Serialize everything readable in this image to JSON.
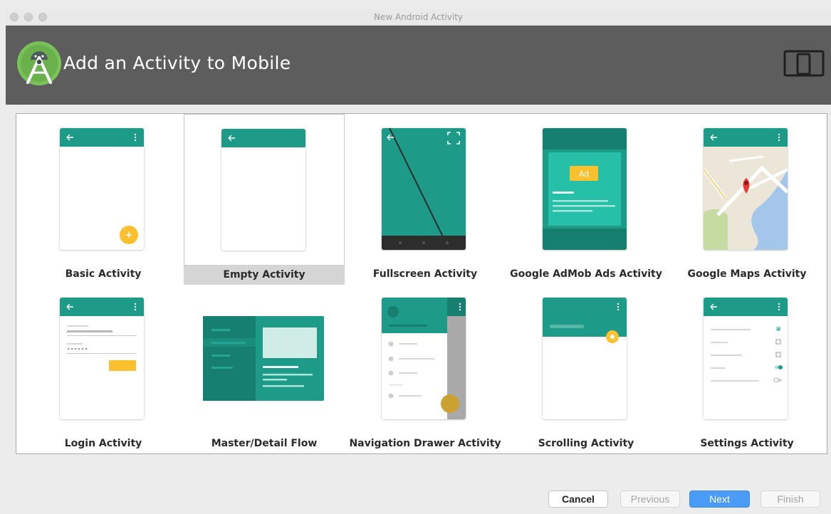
{
  "window": {
    "title": "New Android Activity",
    "header_title": "Add an Activity to Mobile"
  },
  "icons": {
    "logo": "android-studio-logo",
    "device": "phone-tablet-icon"
  },
  "colors": {
    "header_bg": "#5d5d5d",
    "teal": "#1e9b88",
    "teal_dark": "#177f70",
    "accent_yellow": "#fbc02d",
    "primary_button": "#4a9bf5"
  },
  "templates": [
    {
      "id": "basic",
      "label": "Basic Activity",
      "selected": false
    },
    {
      "id": "empty",
      "label": "Empty Activity",
      "selected": true
    },
    {
      "id": "fullscreen",
      "label": "Fullscreen Activity",
      "selected": false
    },
    {
      "id": "admob",
      "label": "Google AdMob Ads Activity",
      "selected": false,
      "badge": "Ad"
    },
    {
      "id": "maps",
      "label": "Google Maps Activity",
      "selected": false
    },
    {
      "id": "login",
      "label": "Login Activity",
      "selected": false
    },
    {
      "id": "masterdetail",
      "label": "Master/Detail Flow",
      "selected": false
    },
    {
      "id": "navdrawer",
      "label": "Navigation Drawer Activity",
      "selected": false
    },
    {
      "id": "scrolling",
      "label": "Scrolling Activity",
      "selected": false
    },
    {
      "id": "settings",
      "label": "Settings Activity",
      "selected": false
    }
  ],
  "buttons": {
    "cancel": "Cancel",
    "previous": "Previous",
    "next": "Next",
    "finish": "Finish"
  }
}
